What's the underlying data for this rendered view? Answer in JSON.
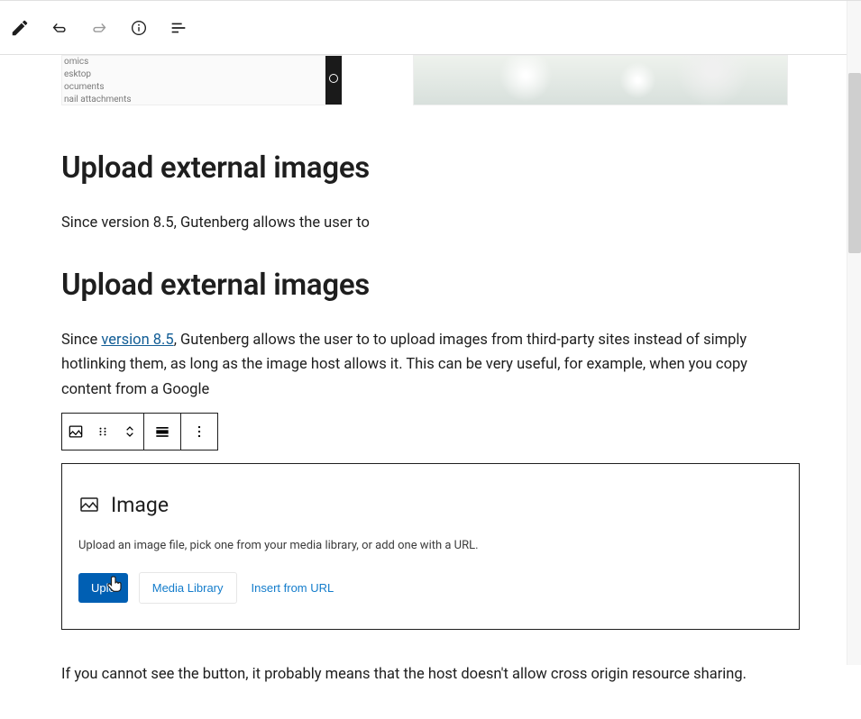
{
  "preview_left_items": [
    "omics",
    "esktop",
    "ocuments",
    "nail attachments"
  ],
  "heading1": "Upload external images",
  "paragraph1": "Since version 8.5, Gutenberg allows the user to",
  "heading2": "Upload external images",
  "paragraph2_prefix": "Since ",
  "paragraph2_link": "version 8.5",
  "paragraph2_suffix": ", Gutenberg allows the user to to upload images from third-party sites instead of simply hotlinking them, as long as the image host allows it. This can be very useful, for example, when you copy content from a Google",
  "image_block": {
    "title": "Image",
    "description": "Upload an image file, pick one from your media library, or add one with a URL.",
    "upload_label": "Uplo",
    "media_library_label": "Media Library",
    "insert_url_label": "Insert from URL"
  },
  "paragraph3": "If you cannot see the button, it probably means that the  host doesn't allow cross origin resource sharing."
}
